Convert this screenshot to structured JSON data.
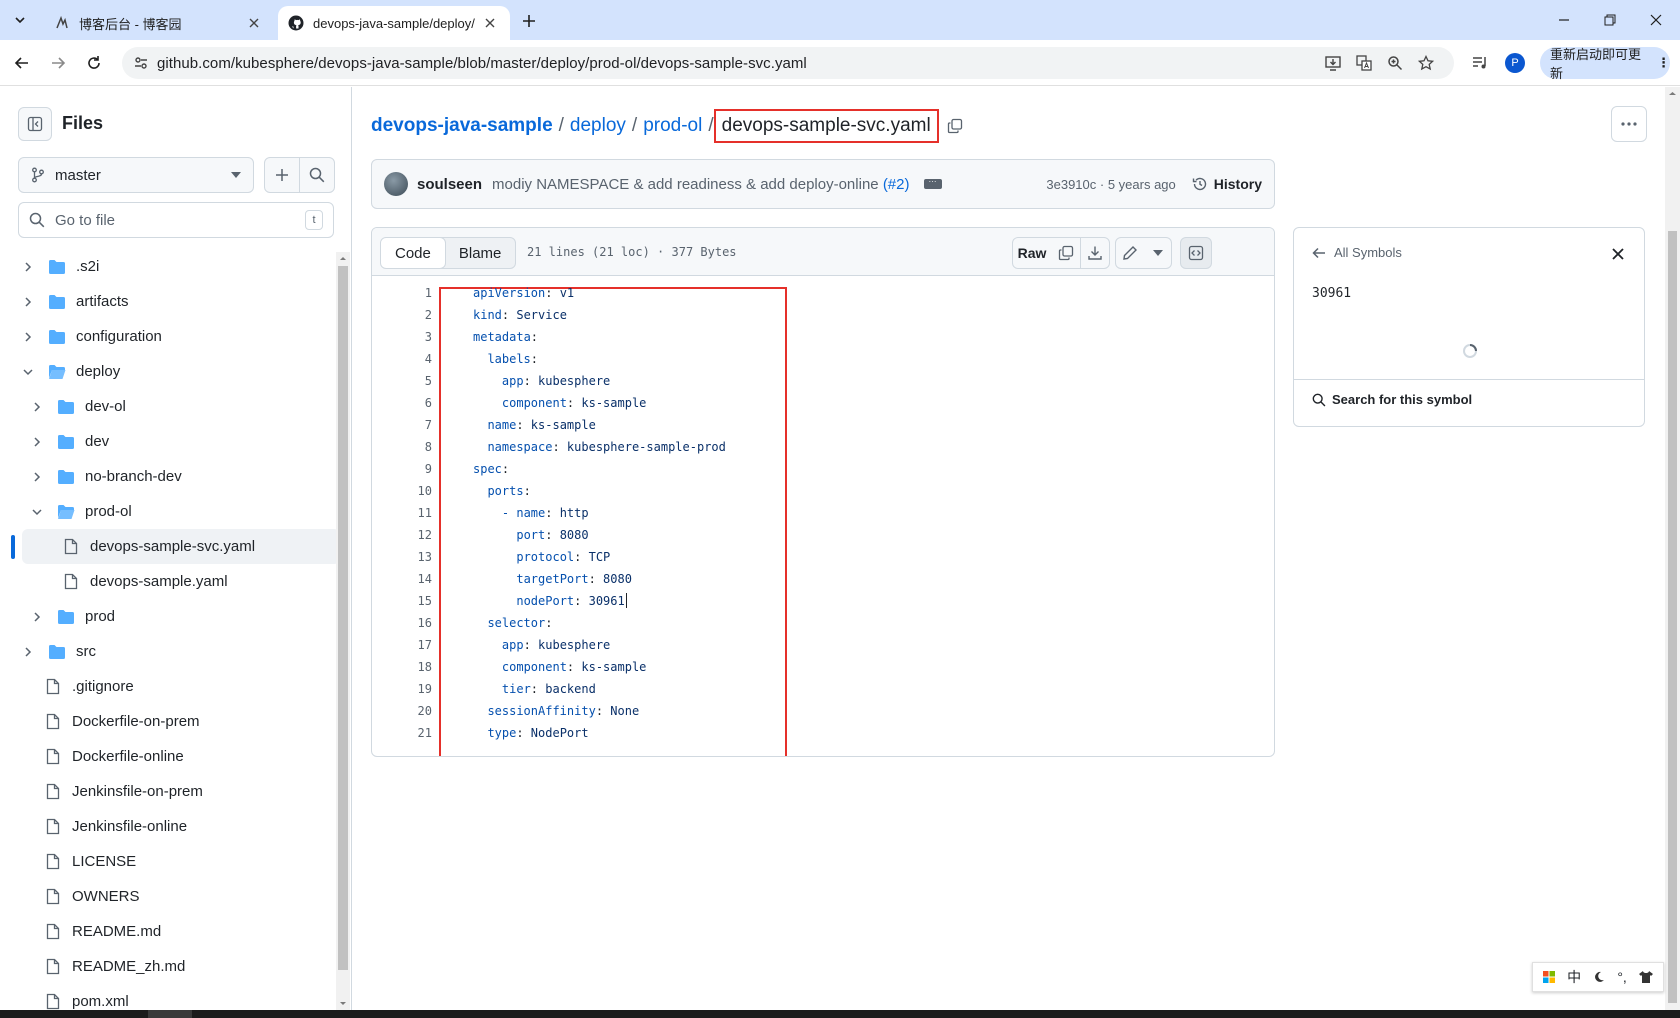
{
  "browser": {
    "tabs": [
      {
        "title": "博客后台 - 博客园",
        "active": false
      },
      {
        "title": "devops-java-sample/deploy/",
        "active": true
      }
    ],
    "url": "github.com/kubesphere/devops-java-sample/blob/master/deploy/prod-ol/devops-sample-svc.yaml",
    "update_button": "重新启动即可更新",
    "profile_initial": "P"
  },
  "sidebar": {
    "title": "Files",
    "branch": "master",
    "go_to_file_placeholder": "Go to file",
    "shortcut_key": "t",
    "tree": [
      {
        "name": ".s2i",
        "type": "dir",
        "depth": 0,
        "expanded": false
      },
      {
        "name": "artifacts",
        "type": "dir",
        "depth": 0,
        "expanded": false
      },
      {
        "name": "configuration",
        "type": "dir",
        "depth": 0,
        "expanded": false
      },
      {
        "name": "deploy",
        "type": "dir",
        "depth": 0,
        "expanded": true
      },
      {
        "name": "dev-ol",
        "type": "dir",
        "depth": 1,
        "expanded": false
      },
      {
        "name": "dev",
        "type": "dir",
        "depth": 1,
        "expanded": false
      },
      {
        "name": "no-branch-dev",
        "type": "dir",
        "depth": 1,
        "expanded": false
      },
      {
        "name": "prod-ol",
        "type": "dir",
        "depth": 1,
        "expanded": true
      },
      {
        "name": "devops-sample-svc.yaml",
        "type": "file",
        "depth": 2,
        "selected": true
      },
      {
        "name": "devops-sample.yaml",
        "type": "file",
        "depth": 2
      },
      {
        "name": "prod",
        "type": "dir",
        "depth": 1,
        "expanded": false
      },
      {
        "name": "src",
        "type": "dir",
        "depth": 0,
        "expanded": false
      },
      {
        "name": ".gitignore",
        "type": "file",
        "depth": 0
      },
      {
        "name": "Dockerfile-on-prem",
        "type": "file",
        "depth": 0
      },
      {
        "name": "Dockerfile-online",
        "type": "file",
        "depth": 0
      },
      {
        "name": "Jenkinsfile-on-prem",
        "type": "file",
        "depth": 0
      },
      {
        "name": "Jenkinsfile-online",
        "type": "file",
        "depth": 0
      },
      {
        "name": "LICENSE",
        "type": "file",
        "depth": 0
      },
      {
        "name": "OWNERS",
        "type": "file",
        "depth": 0
      },
      {
        "name": "README.md",
        "type": "file",
        "depth": 0
      },
      {
        "name": "README_zh.md",
        "type": "file",
        "depth": 0
      },
      {
        "name": "pom.xml",
        "type": "file",
        "depth": 0
      }
    ]
  },
  "breadcrumb": {
    "repo": "devops-java-sample",
    "parts": [
      "deploy",
      "prod-ol"
    ],
    "current": "devops-sample-svc.yaml",
    "separator": "/"
  },
  "commit": {
    "author": "soulseen",
    "message": "modiy NAMESPACE & add readiness & add deploy-online",
    "pr": "(#2)",
    "meta": "3e3910c · 5 years ago",
    "history_label": "History"
  },
  "file": {
    "tabs": [
      "Code",
      "Blame"
    ],
    "active_tab": "Code",
    "stats": "21 lines (21 loc) · 377 Bytes",
    "raw_label": "Raw",
    "lines": [
      {
        "indent": 0,
        "key": "apiVersion",
        "value": "v1"
      },
      {
        "indent": 0,
        "key": "kind",
        "value": "Service"
      },
      {
        "indent": 0,
        "key": "metadata",
        "value": ""
      },
      {
        "indent": 1,
        "key": "labels",
        "value": ""
      },
      {
        "indent": 2,
        "key": "app",
        "value": "kubesphere"
      },
      {
        "indent": 2,
        "key": "component",
        "value": "ks-sample"
      },
      {
        "indent": 1,
        "key": "name",
        "value": "ks-sample"
      },
      {
        "indent": 1,
        "key": "namespace",
        "value": "kubesphere-sample-prod"
      },
      {
        "indent": 0,
        "key": "spec",
        "value": ""
      },
      {
        "indent": 1,
        "key": "ports",
        "value": ""
      },
      {
        "indent": 2,
        "key": "- name",
        "value": "http"
      },
      {
        "indent": 3,
        "key": "port",
        "value": "8080"
      },
      {
        "indent": 3,
        "key": "protocol",
        "value": "TCP"
      },
      {
        "indent": 3,
        "key": "targetPort",
        "value": "8080"
      },
      {
        "indent": 3,
        "key": "nodePort",
        "value": "30961",
        "caret": true
      },
      {
        "indent": 1,
        "key": "selector",
        "value": ""
      },
      {
        "indent": 2,
        "key": "app",
        "value": "kubesphere"
      },
      {
        "indent": 2,
        "key": "component",
        "value": "ks-sample"
      },
      {
        "indent": 2,
        "key": "tier",
        "value": "backend"
      },
      {
        "indent": 1,
        "key": "sessionAffinity",
        "value": "None"
      },
      {
        "indent": 1,
        "key": "type",
        "value": "NodePort"
      }
    ]
  },
  "symbols": {
    "back_label": "All Symbols",
    "term": "30961",
    "search_label": "Search for this symbol"
  },
  "ime": [
    "中",
    "°,"
  ],
  "colors": {
    "accent": "#0969da",
    "highlight": "#e5302a"
  }
}
